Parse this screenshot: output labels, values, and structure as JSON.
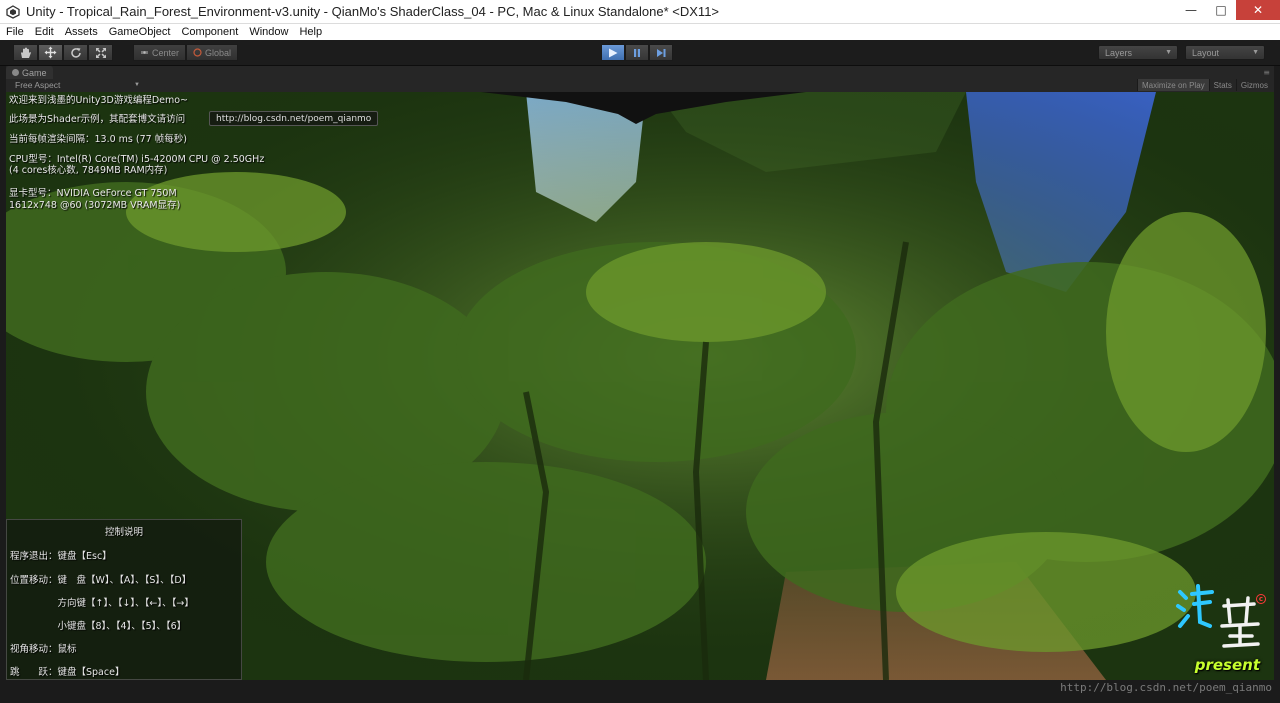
{
  "window": {
    "title": "Unity - Tropical_Rain_Forest_Environment-v3.unity - QianMo's ShaderClass_04 - PC, Mac & Linux Standalone* <DX11>",
    "minimize": "—",
    "maximize": "□",
    "close": "✕"
  },
  "menu": [
    "File",
    "Edit",
    "Assets",
    "GameObject",
    "Component",
    "Window",
    "Help"
  ],
  "toolbar": {
    "tools": [
      "hand-icon",
      "move-icon",
      "rotate-icon",
      "scale-icon"
    ],
    "pivot_center": "Center",
    "pivot_global": "Global",
    "layers_label": "Layers",
    "layout_label": "Layout"
  },
  "game_panel": {
    "tab_label": "Game",
    "aspect": "Free Aspect",
    "maximize_on_play": "Maximize on Play",
    "stats": "Stats",
    "gizmos": "Gizmos"
  },
  "hud": {
    "welcome": "欢迎来到浅墨的Unity3D游戏编程Demo~",
    "shader_note": "此场景为Shader示例，其配套博文请访问",
    "url": "http://blog.csdn.net/poem_qianmo",
    "frame_interval": "当前每帧渲染间隔：13.0 ms (77 帧每秒)",
    "cpu_line1": "CPU型号：Intel(R) Core(TM) i5-4200M CPU @ 2.50GHz",
    "cpu_line2": "(4 cores核心数, 7849MB RAM内存)",
    "gpu_line1": "显卡型号：NVIDIA GeForce GT 750M",
    "gpu_line2": "1612x748 @60 (3072MB VRAM显存)"
  },
  "controls": {
    "title": "控制说明",
    "rows": [
      "程序退出：键盘【Esc】",
      "位置移动：键　盘【W】、【A】、【S】、【D】",
      "　　　　　方向键【↑】、【↓】、【←】、【→】",
      "　　　　　小键盘【8】、【4】、【5】、【6】",
      "视角移动：鼠标",
      "跳　　跃：键盘【Space】"
    ]
  },
  "logo": {
    "chars": "浅墨",
    "present": "present",
    "copyright": "c"
  },
  "watermark": "http://blog.csdn.net/poem_qianmo",
  "colors": {
    "play_active": "#4f7fc2",
    "editor_bg": "#1c1c1c",
    "logo_blue": "#2ec8ff",
    "logo_green": "#c6ff2e"
  }
}
